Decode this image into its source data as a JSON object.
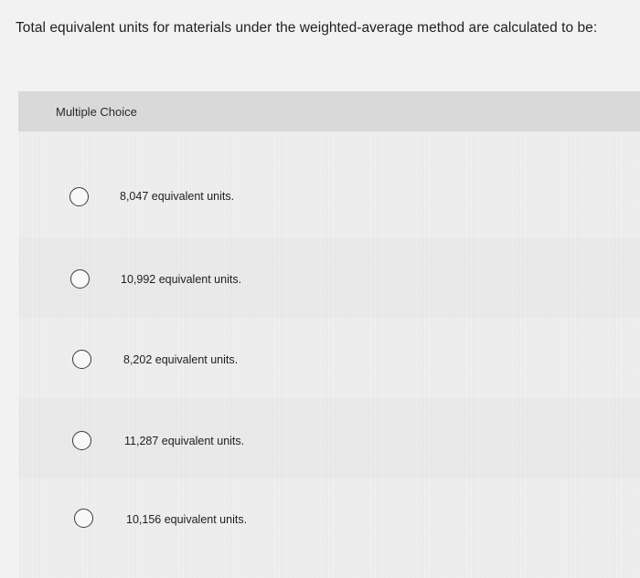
{
  "question": {
    "text": "Total equivalent units for materials under the weighted-average method are calculated to be:"
  },
  "panel": {
    "header_label": "Multiple Choice"
  },
  "options": [
    {
      "label": "8,047 equivalent units.",
      "selected": false
    },
    {
      "label": "10,992 equivalent units.",
      "selected": false
    },
    {
      "label": "8,202 equivalent units.",
      "selected": false
    },
    {
      "label": "11,287 equivalent units.",
      "selected": false
    },
    {
      "label": "10,156 equivalent units.",
      "selected": false
    }
  ]
}
